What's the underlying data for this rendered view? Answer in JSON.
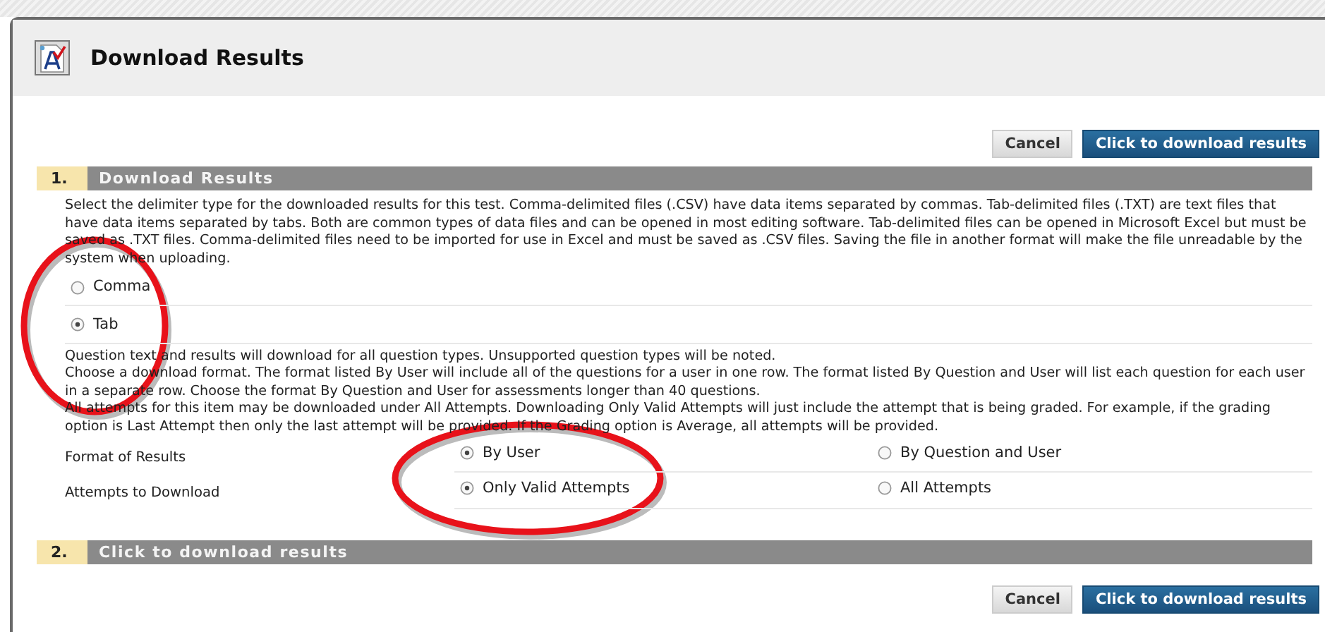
{
  "header": {
    "title": "Download Results"
  },
  "top_actions": [
    {
      "label": "Cancel",
      "kind": "secondary"
    },
    {
      "label": "Click to download results",
      "kind": "primary"
    }
  ],
  "section_1": {
    "number": "1.",
    "title": "Download Results",
    "description": "Select the delimiter type for the downloaded results for this test. Comma-delimited files (.CSV) have data items separated by commas. Tab-delimited files (.TXT) are text files that have data items separated by tabs. Both are common types of data files and can be opened in most editing software. Tab-delimited files can be opened in Microsoft Excel but must be saved as .TXT files. Comma-delimited files need to be imported for use in Excel and must be saved as .CSV files. Saving the file in another format will make the file unreadable by the system when uploading.",
    "delimiter_options": [
      {
        "label": "Comma",
        "selected": false
      },
      {
        "label": "Tab",
        "selected": true
      }
    ],
    "notes": [
      "Question text and results will download for all question types. Unsupported question types will be noted.",
      "Choose a download format. The format listed By User will include all of the questions for a user in one row. The format listed By Question and User will list each question for each user in a separate row. Choose the format By Question and User for assessments longer than 40 questions.",
      "All attempts for this item may be downloaded under All Attempts. Downloading Only Valid Attempts will just include the attempt that is being graded. For example, if the grading option is Last Attempt then only the last attempt will be provided. If the Grading option is Average, all attempts will be provided."
    ],
    "fields": [
      {
        "label": "Format of Results",
        "options": [
          {
            "label": "By User",
            "selected": true
          },
          {
            "label": "By Question and User",
            "selected": false
          }
        ]
      },
      {
        "label": "Attempts to Download",
        "options": [
          {
            "label": "Only Valid Attempts",
            "selected": true
          },
          {
            "label": "All Attempts",
            "selected": false
          }
        ]
      }
    ]
  },
  "section_2": {
    "number": "2.",
    "title": "Click to download results"
  },
  "bottom_actions": [
    {
      "label": "Cancel",
      "kind": "secondary"
    },
    {
      "label": "Click to download results",
      "kind": "primary"
    }
  ]
}
